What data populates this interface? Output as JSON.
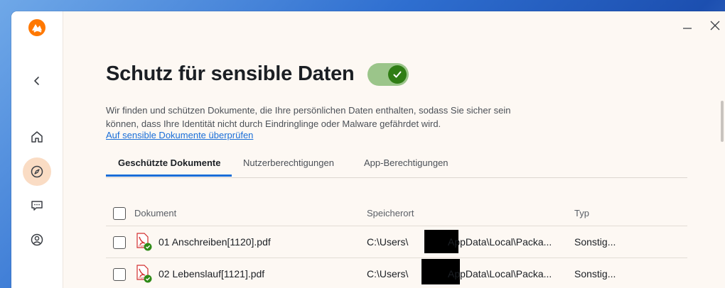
{
  "page": {
    "title": "Schutz für sensible Daten",
    "description": "Wir finden und schützen Dokumente, die Ihre persönlichen Daten enthalten, sodass Sie sicher sein können, dass Ihre Identität nicht durch Eindringlinge oder Malware gefährdet wird.",
    "check_link": "Auf sensible Dokumente überprüfen",
    "toggle_on": true
  },
  "tabs": [
    {
      "label": "Geschützte Dokumente",
      "active": true
    },
    {
      "label": "Nutzerberechtigungen",
      "active": false
    },
    {
      "label": "App-Berechtigungen",
      "active": false
    }
  ],
  "table": {
    "columns": {
      "document": "Dokument",
      "location": "Speicherort",
      "type": "Typ"
    },
    "rows": [
      {
        "name": "01 Anschreiben[1120].pdf",
        "location_prefix": "C:\\Users\\",
        "location_suffix": "AppData\\Local\\Packa...",
        "type": "Sonstig..."
      },
      {
        "name": "02 Lebenslauf[1121].pdf",
        "location_prefix": "C:\\Users\\",
        "location_suffix": "AppData\\Local\\Packa...",
        "type": "Sonstig..."
      }
    ]
  },
  "sidebar": {
    "items": [
      {
        "icon": "back-arrow-icon"
      },
      {
        "icon": "home-icon"
      },
      {
        "icon": "compass-icon",
        "active": true
      },
      {
        "icon": "chat-icon"
      },
      {
        "icon": "account-icon"
      }
    ]
  },
  "colors": {
    "accent": "#1a6ed8",
    "brand": "#ff7800",
    "toggle_on": "#2f7d14",
    "background": "#fdf8f3"
  }
}
